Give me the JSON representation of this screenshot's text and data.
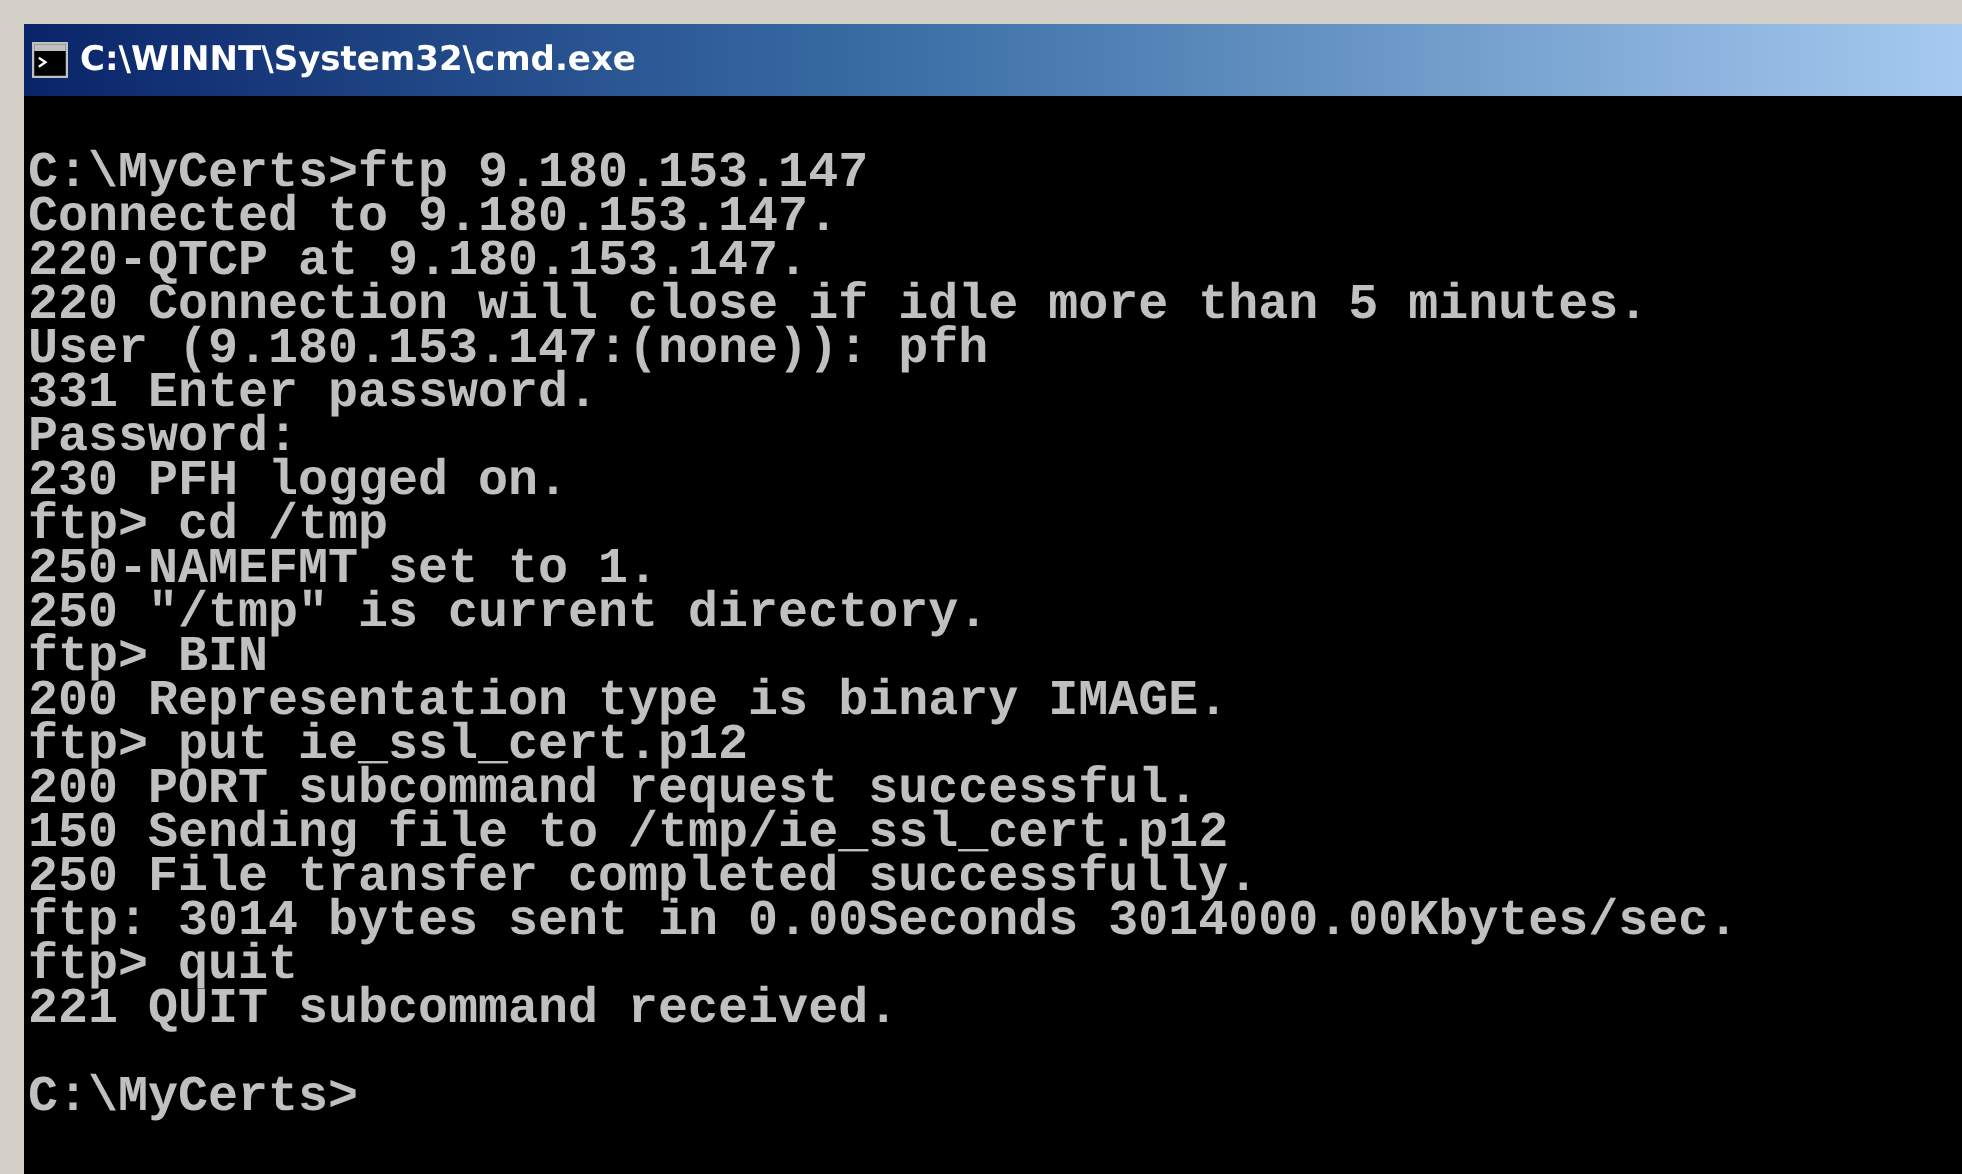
{
  "window": {
    "title": "C:\\WINNT\\System32\\cmd.exe"
  },
  "console": {
    "lines": [
      {
        "text": "C:\\MyCerts>ftp 9.180.153.147",
        "blank_before": false
      },
      {
        "text": "Connected to 9.180.153.147.",
        "blank_before": false
      },
      {
        "text": "220-QTCP at 9.180.153.147.",
        "blank_before": false
      },
      {
        "text": "220 Connection will close if idle more than 5 minutes.",
        "blank_before": false
      },
      {
        "text": "User (9.180.153.147:(none)): pfh",
        "blank_before": false
      },
      {
        "text": "331 Enter password.",
        "blank_before": false
      },
      {
        "text": "Password:",
        "blank_before": false
      },
      {
        "text": "230 PFH logged on.",
        "blank_before": false
      },
      {
        "text": "ftp> cd /tmp",
        "blank_before": false
      },
      {
        "text": "250-NAMEFMT set to 1.",
        "blank_before": false
      },
      {
        "text": "250 \"/tmp\" is current directory.",
        "blank_before": false
      },
      {
        "text": "ftp> BIN",
        "blank_before": false
      },
      {
        "text": "200 Representation type is binary IMAGE.",
        "blank_before": false
      },
      {
        "text": "ftp> put ie_ssl_cert.p12",
        "blank_before": false
      },
      {
        "text": "200 PORT subcommand request successful.",
        "blank_before": false
      },
      {
        "text": "150 Sending file to /tmp/ie_ssl_cert.p12",
        "blank_before": false
      },
      {
        "text": "250 File transfer completed successfully.",
        "blank_before": false
      },
      {
        "text": "ftp: 3014 bytes sent in 0.00Seconds 3014000.00Kbytes/sec.",
        "blank_before": false
      },
      {
        "text": "ftp> quit",
        "blank_before": false
      },
      {
        "text": "221 QUIT subcommand received.",
        "blank_before": false
      },
      {
        "text": "C:\\MyCerts>",
        "blank_before": true
      }
    ]
  }
}
